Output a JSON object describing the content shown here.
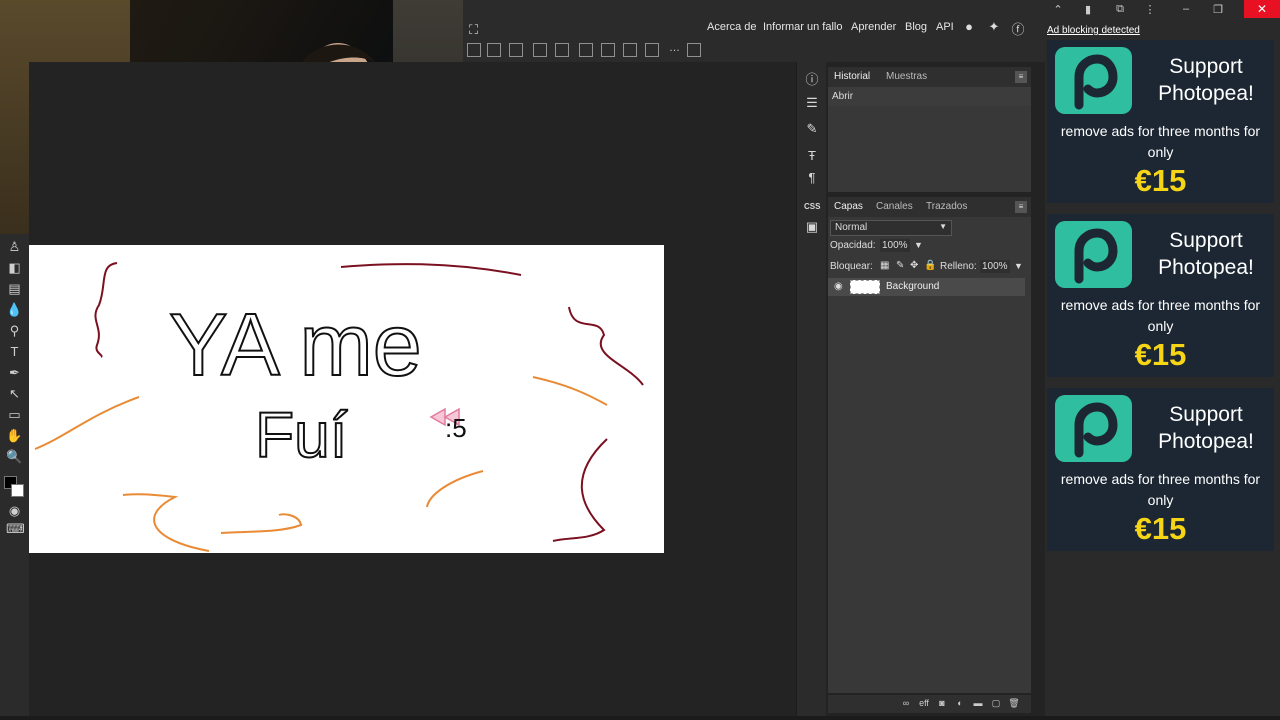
{
  "menu": {
    "about": "Acerca de",
    "report": "Informar un fallo",
    "learn": "Aprender",
    "blog": "Blog",
    "api": "API",
    "icons": [
      "reddit-icon",
      "twitter-icon",
      "facebook-icon"
    ]
  },
  "history": {
    "tabs": [
      "Historial",
      "Muestras"
    ],
    "items": [
      "Abrir"
    ]
  },
  "layers": {
    "tabs": [
      "Capas",
      "Canales",
      "Trazados"
    ],
    "blend_mode": "Normal",
    "opacity_label": "Opacidad:",
    "opacity_value": "100%",
    "lock_label": "Bloquear:",
    "fill_label": "Relleno:",
    "fill_value": "100%",
    "items": [
      {
        "name": "Background"
      }
    ]
  },
  "canvas": {
    "line1": "YA me",
    "line2": "Fuí",
    "emoticon": ":5"
  },
  "ads": {
    "notice": "Ad blocking detected",
    "cards": [
      {
        "headline": "Support Photopea!",
        "sub": "remove ads for three months for only",
        "price": "€15"
      },
      {
        "headline": "Support Photopea!",
        "sub": "remove ads for three months for only",
        "price": "€15"
      },
      {
        "headline": "Support Photopea!",
        "sub": "remove ads for three months for only",
        "price": "€15"
      }
    ]
  },
  "colors": {
    "ui_bg": "#232323",
    "panel_bg": "#383838",
    "accent_teal": "#2fbfa0",
    "price_yellow": "#f5d516",
    "close_red": "#e81123",
    "stroke_dark_red": "#7a1020",
    "stroke_orange": "#e98a35",
    "stroke_black": "#111111"
  }
}
